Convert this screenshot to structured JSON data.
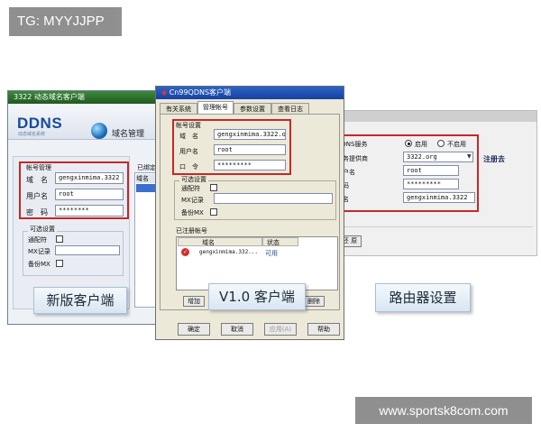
{
  "watermark": {
    "top": "TG: MYYJJPP",
    "bottom": "www.sportsk8com.com"
  },
  "colors": {
    "highlight_box": "#c62828",
    "ddns_blue": "#1a4b9a"
  },
  "win1": {
    "title": "3322 动态域名客户端",
    "logo": "DDNS",
    "logo_sub": "动态域名系统",
    "tab": "域名管理",
    "account_group": "帐号管理",
    "fields": [
      {
        "label": "域　名",
        "value": "gengxinmima.3322"
      },
      {
        "label": "用户名",
        "value": "root"
      },
      {
        "label": "密　码",
        "value": "********"
      }
    ],
    "options_group": "可选设置",
    "options": [
      {
        "label": "通配符",
        "type": "checkbox"
      },
      {
        "label": "MX记录",
        "type": "input"
      },
      {
        "label": "备份MX",
        "type": "checkbox"
      }
    ],
    "list_group": "已绑定",
    "list_header": "域名",
    "caption": "新版客户端"
  },
  "win2": {
    "title": "Cn99QDNS客户端",
    "tabs": [
      "有关系统",
      "管理帐号",
      "参数设置",
      "查看日志"
    ],
    "account_group": "帐号设置",
    "fields": [
      {
        "label": "域　名",
        "value": "gengxinmima.3322.o"
      },
      {
        "label": "用户名",
        "value": "root"
      },
      {
        "label": "口　令",
        "value": "*********"
      }
    ],
    "options_group": "可选设置",
    "options": [
      {
        "label": "通配符",
        "type": "checkbox"
      },
      {
        "label": "MX记录",
        "type": "input"
      },
      {
        "label": "备份MX",
        "type": "checkbox"
      }
    ],
    "registered_group": "已注册帐号",
    "list_columns": [
      "域名",
      "状态"
    ],
    "list_rows": [
      {
        "domain": "gengxinmima.332...",
        "status": "可用"
      }
    ],
    "btn_add": "增加",
    "btn_delete": "删除",
    "caption": "V1.0 客户端",
    "bottom_buttons": [
      "确定",
      "取消",
      "应用(A)",
      "帮助"
    ]
  },
  "win3": {
    "title": "动态DNS",
    "service_label": "DDNS服务",
    "radio_on": "启用",
    "radio_off": "不启用",
    "provider_label": "服务提供商",
    "provider_value": "3322.org",
    "register_link": "注册去",
    "user_label": "用户名",
    "user_value": "root",
    "pwd_label": "密码",
    "pwd_value": "*********",
    "domain_label": "域名",
    "domain_value": "gengxinmima.3322",
    "btn_save": "保 存",
    "btn_restore": "还 原",
    "caption": "路由器设置"
  }
}
